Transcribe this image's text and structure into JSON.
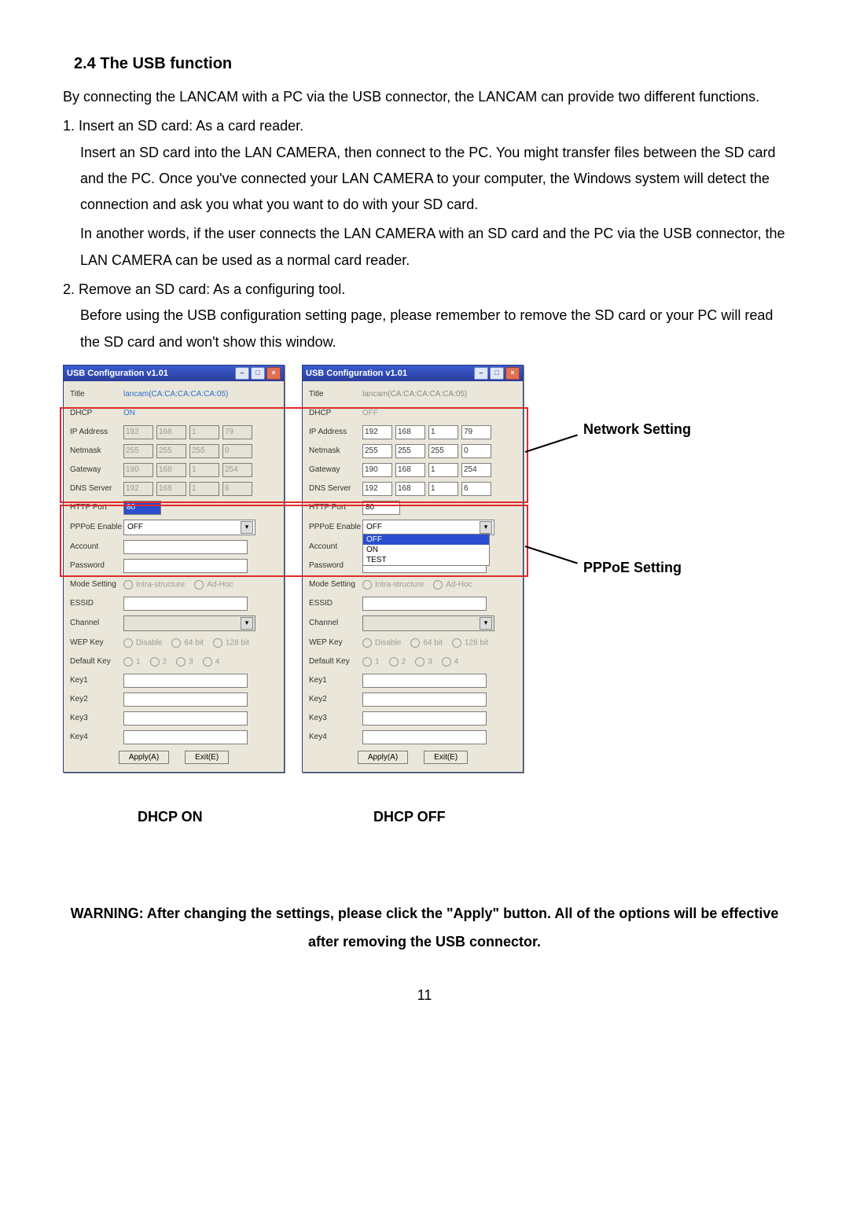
{
  "heading": "2.4 The USB function",
  "intro": "By connecting the LANCAM with a PC via the USB connector, the LANCAM can provide two different functions.",
  "item1_lead": "1. Insert an SD card: As a card reader.",
  "item1_p1": "Insert an SD card into the LAN CAMERA, then connect to the PC. You might transfer files between the SD card and the PC. Once you've connected your LAN CAMERA to your computer, the Windows system will detect the connection and ask you what you want to do with your SD card.",
  "item1_p2": "In another words, if the user connects the LAN CAMERA with an SD card and the PC via the USB connector, the LAN CAMERA can be used as a normal card reader.",
  "item2_lead": "2. Remove an SD card: As a configuring tool.",
  "item2_p1": "Before using the USB configuration setting page, please remember to remove the SD card or your PC will read the SD card and won't show this window.",
  "callouts": {
    "network": "Network Setting",
    "pppoe": "PPPoE Setting"
  },
  "captions": {
    "left": "DHCP ON",
    "right": "DHCP OFF"
  },
  "warning": "WARNING: After changing the settings, please click the \"Apply\" button. All of the options will be effective after removing the USB connector.",
  "pagenum": "11",
  "window": {
    "title": "USB Configuration v1.01",
    "title_value": "lancam(CA:CA:CA:CA:CA:05)",
    "labels": {
      "title": "Title",
      "dhcp": "DHCP",
      "ip": "IP Address",
      "netmask": "Netmask",
      "gateway": "Gateway",
      "dns": "DNS Server",
      "http": "HTTP Port",
      "pppoe": "PPPoE Enable",
      "account": "Account",
      "password": "Password",
      "mode": "Mode Setting",
      "essid": "ESSID",
      "channel": "Channel",
      "wep": "WEP Key",
      "defkey": "Default Key",
      "key1": "Key1",
      "key2": "Key2",
      "key3": "Key3",
      "key4": "Key4"
    },
    "radio": {
      "infra": "Intra-structure",
      "adhoc": "Ad-Hoc",
      "disable": "Disable",
      "b64": "64 bit",
      "b128": "128 bit",
      "k1": "1",
      "k2": "2",
      "k3": "3",
      "k4": "4"
    },
    "buttons": {
      "apply": "Apply(A)",
      "exit": "Exit(E)"
    },
    "left": {
      "dhcp": "ON",
      "ip": [
        "192",
        "168",
        "1",
        "79"
      ],
      "mask": [
        "255",
        "255",
        "255",
        "0"
      ],
      "gw": [
        "190",
        "168",
        "1",
        "254"
      ],
      "dns": [
        "192",
        "168",
        "1",
        "6"
      ],
      "http": "80",
      "pppoe_sel": "OFF"
    },
    "right": {
      "dhcp": "OFF",
      "ip": [
        "192",
        "168",
        "1",
        "79"
      ],
      "mask": [
        "255",
        "255",
        "255",
        "0"
      ],
      "gw": [
        "190",
        "168",
        "1",
        "254"
      ],
      "dns": [
        "192",
        "168",
        "1",
        "6"
      ],
      "http": "80",
      "pppoe_sel": "OFF",
      "pppoe_options": [
        "OFF",
        "ON",
        "TEST"
      ]
    }
  }
}
